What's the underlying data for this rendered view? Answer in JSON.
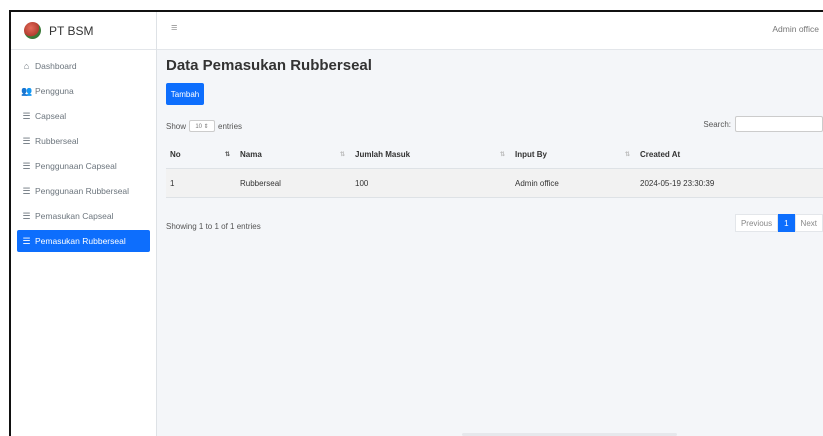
{
  "brand": {
    "name": "PT BSM",
    "logo_icon": "brand-logo-icon"
  },
  "sidebar": {
    "items": [
      {
        "label": "Dashboard",
        "icon": "home-icon",
        "glyph": "⌂",
        "active": false
      },
      {
        "label": "Pengguna",
        "icon": "users-icon",
        "glyph": "👥",
        "active": false
      },
      {
        "label": "Capseal",
        "icon": "list-icon",
        "glyph": "☰",
        "active": false
      },
      {
        "label": "Rubberseal",
        "icon": "list-icon",
        "glyph": "☰",
        "active": false
      },
      {
        "label": "Penggunaan Capseal",
        "icon": "list-icon",
        "glyph": "☰",
        "active": false
      },
      {
        "label": "Penggunaan Rubberseal",
        "icon": "list-icon",
        "glyph": "☰",
        "active": false
      },
      {
        "label": "Pemasukan Capseal",
        "icon": "list-icon",
        "glyph": "☰",
        "active": false
      },
      {
        "label": "Pemasukan Rubberseal",
        "icon": "list-icon",
        "glyph": "☰",
        "active": true
      }
    ]
  },
  "topbar": {
    "menu_glyph": "≡",
    "user": "Admin office"
  },
  "main": {
    "title": "Data Pemasukan Rubberseal",
    "add_button": "Tambah",
    "show_label": "Show",
    "entries_value": "10 ⇕",
    "entries_label": "entries",
    "search_label": "Search:",
    "table": {
      "headers": [
        "No",
        "Nama",
        "Jumlah Masuk",
        "Input By",
        "Created At"
      ],
      "rows": [
        [
          "1",
          "Rubberseal",
          "100",
          "Admin office",
          "2024-05-19 23:30:39"
        ]
      ]
    },
    "info": "Showing 1 to 1 of 1 entries",
    "pagination": {
      "previous": "Previous",
      "current": "1",
      "next": "Next"
    }
  },
  "colors": {
    "accent": "#0d6efd",
    "sidebar_bg": "#ffffff",
    "content_bg": "#f4f6f9"
  }
}
